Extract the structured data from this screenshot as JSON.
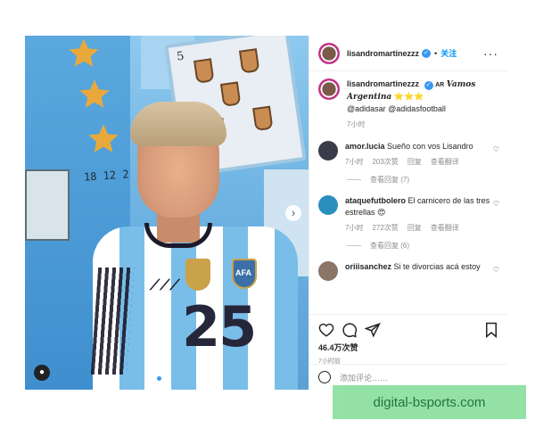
{
  "post": {
    "username": "lisandromartinezzz",
    "follow_label": "关注",
    "more_label": "···",
    "caption": {
      "username": "lisandromartinezzz",
      "flag_text": "AR",
      "script_text": "Vamos Argentina",
      "stars": "⭐⭐⭐",
      "mentions": "@adidasar @adidasfootball",
      "time": "7小时"
    },
    "comments": [
      {
        "user": "amor.lucia",
        "text": "Sueño con vos Lisandro",
        "time": "7小时",
        "likes": "203次赞",
        "reply": "回复",
        "translate": "查看翻译",
        "replies": "查看回复 (7)",
        "avatar_color": "#3b3b4a"
      },
      {
        "user": "ataquefutbolero",
        "text": "El carnicero de las tres estrellas",
        "emoji": "😍",
        "time": "7小时",
        "likes": "272次赞",
        "reply": "回复",
        "translate": "查看翻译",
        "replies": "查看回复 (6)",
        "avatar_color": "#2a8fbf"
      },
      {
        "user": "oriiisanchez",
        "text": "Si te divorcias acá estoy",
        "avatar_color": "#8a7566"
      }
    ],
    "likes_count": "46.4万次赞",
    "time_ago": "7小时前",
    "add_comment_placeholder": "添加评论……",
    "photo": {
      "card_number": "5",
      "date_text": "18 12 2",
      "crest_text": "AFA",
      "jersey_number": "25",
      "slide_total": 2,
      "active_slide": 1
    }
  },
  "watermark": "digital-bsports.com",
  "colors": {
    "link": "#0095f6",
    "verified": "#3897f0",
    "muted": "#8e8e8e",
    "watermark_bg": "#8ee0a0"
  }
}
